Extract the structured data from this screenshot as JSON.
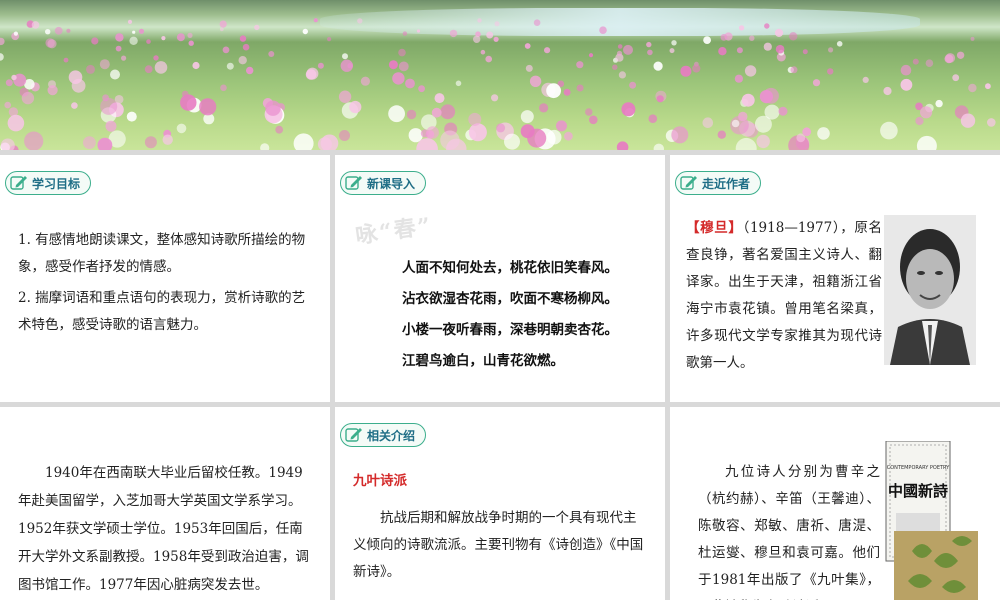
{
  "banner": {
    "image": "pink-wildflower-meadow-by-lake"
  },
  "panels": {
    "goals": {
      "tag": "学习目标",
      "items": [
        "1. 有感情地朗读课文，整体感知诗歌所描绘的物象，感受作者抒发的情感。",
        "2. 揣摩词语和重点语句的表现力，赏析诗歌的艺术特色，感受诗歌的语言魅力。"
      ]
    },
    "intro": {
      "tag": "新课导入",
      "watermark": "咏“春”",
      "lines": [
        "人面不知何处去，桃花依旧笑春风。",
        "沾衣欲湿杏花雨，吹面不寒杨柳风。",
        "小楼一夜听春雨，深巷明朝卖杏花。",
        "江碧鸟逾白，山青花欲燃。"
      ]
    },
    "author": {
      "tag": "走近作者",
      "name": "【穆旦】",
      "text": "（1918—1977），原名查良铮，著名爱国主义诗人、翻译家。出生于天津，祖籍浙江省海宁市袁花镇。曾用笔名梁真，许多现代文学专家推其为现代诗歌第一人。"
    },
    "bio": {
      "text": "1940年在西南联大毕业后留校任教。1949年赴美国留学，入芝加哥大学英国文学系学习。1952年获文学硕士学位。1953年回国后，任南开大学外文系副教授。1958年受到政治迫害，调图书馆工作。1977年因心脏病突发去世。"
    },
    "related": {
      "tag": "相关介绍",
      "title": "九叶诗派",
      "text": "抗战后期和解放战争时期的一个具有现代主义倾向的诗歌流派。主要刊物有《诗创造》《中国新诗》。"
    },
    "poets": {
      "text": "九位诗人分别为曹辛之（杭约赫）、辛笛（王馨迪）、陈敬容、郑敏、唐祈、唐湜、杜运燮、穆旦和袁可嘉。他们于1981年出版了《九叶集》，因此被称为九叶诗派。",
      "book_cover_text": "中國新詩",
      "book_cover_sub": "CONTEMPORARY POETRY"
    }
  },
  "colors": {
    "tag_border": "#3cae8c",
    "tag_text": "#1f6e86",
    "highlight": "#d42a2a"
  }
}
